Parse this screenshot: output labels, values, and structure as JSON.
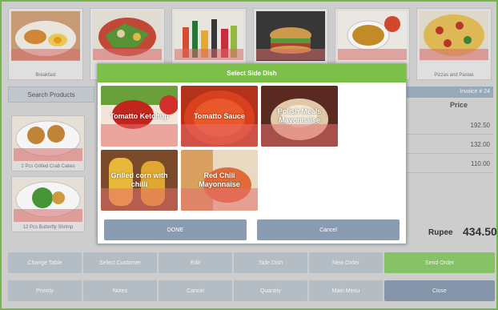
{
  "categories": [
    {
      "label": "Breakfast"
    },
    {
      "label": ""
    },
    {
      "label": ""
    },
    {
      "label": ""
    },
    {
      "label": ""
    },
    {
      "label": "Pizzas and Pastas"
    }
  ],
  "search": {
    "label": "Search Products"
  },
  "invoice": {
    "label": "Invoice # 24"
  },
  "price_header": "Price",
  "prices": [
    "192.50",
    "132.00",
    "110.00"
  ],
  "products": [
    {
      "label": "2 Pcs Grilled Crab Cakes"
    },
    {
      "label": "12 Pcs Butterfly Shrimp"
    }
  ],
  "total": {
    "label": "Rupee",
    "value": "434.50"
  },
  "buttons_row1": [
    {
      "label": "Change Table"
    },
    {
      "label": "Select Customer"
    },
    {
      "label": "Edit"
    },
    {
      "label": "Side Dish"
    },
    {
      "label": "New Order"
    },
    {
      "label": "Send Order"
    }
  ],
  "buttons_row2": [
    {
      "label": "Priority"
    },
    {
      "label": "Notes"
    },
    {
      "label": "Cancel"
    },
    {
      "label": "Quantity"
    },
    {
      "label": "Main Menu"
    },
    {
      "label": "Close"
    }
  ],
  "dialog": {
    "title": "Select Side Dish",
    "items": [
      {
        "label": "Tomatto Ketchup"
      },
      {
        "label": "Tomatto Sauce"
      },
      {
        "label": "Polish Meals Mayonnaise"
      },
      {
        "label": "Grilled corn with chilli"
      },
      {
        "label": "Red Chili Mayonnaise"
      }
    ],
    "done_label": "DONE",
    "cancel_label": "Cancel"
  },
  "colors": {
    "accent": "#7cc04a",
    "button": "#bcc4cc",
    "dialog_button": "#8a9cb1"
  }
}
